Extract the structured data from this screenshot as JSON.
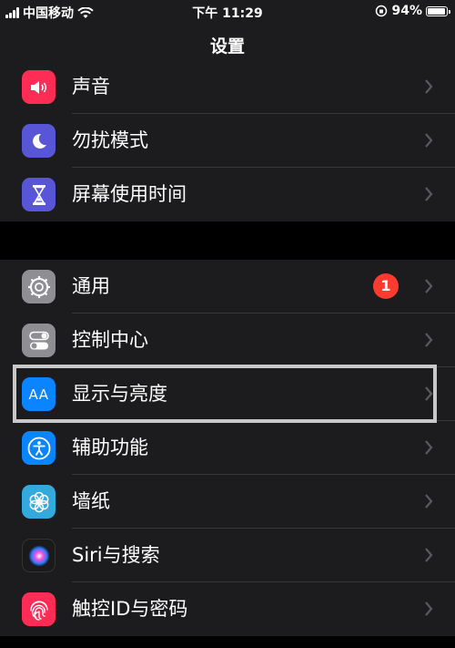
{
  "status_bar": {
    "carrier": "中国移动",
    "time": "下午 11:29",
    "battery_percent": "94%",
    "battery_level": 0.94
  },
  "nav": {
    "title": "设置"
  },
  "group1": [
    {
      "label": "声音",
      "icon": "speaker-icon",
      "color": "#ff2d55"
    },
    {
      "label": "勿扰模式",
      "icon": "moon-icon",
      "color": "#5856d6"
    },
    {
      "label": "屏幕使用时间",
      "icon": "hourglass-icon",
      "color": "#5856d6"
    }
  ],
  "group2": [
    {
      "label": "通用",
      "icon": "gear-icon",
      "color": "#8e8e93",
      "badge": "1"
    },
    {
      "label": "控制中心",
      "icon": "switches-icon",
      "color": "#8e8e93"
    },
    {
      "label": "显示与亮度",
      "icon": "text-size-icon",
      "color": "#0a84ff",
      "icon_text": "AA"
    },
    {
      "label": "辅助功能",
      "icon": "accessibility-icon",
      "color": "#0a84ff"
    },
    {
      "label": "墙纸",
      "icon": "flower-icon",
      "color": "#34aadc"
    },
    {
      "label": "Siri与搜索",
      "icon": "siri-icon",
      "color": "#222"
    },
    {
      "label": "触控ID与密码",
      "icon": "fingerprint-icon",
      "color": "#ff2d55"
    }
  ]
}
